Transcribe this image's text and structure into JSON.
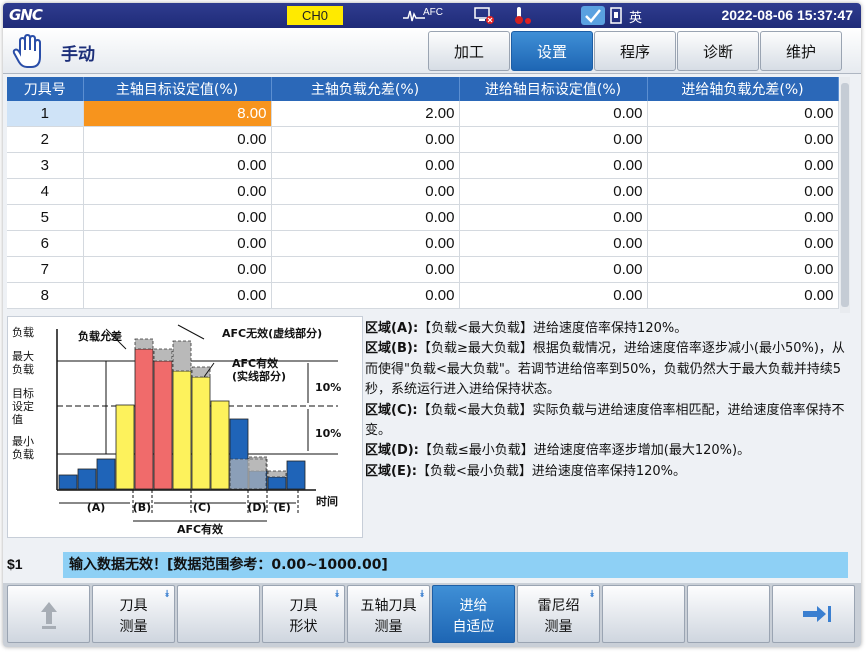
{
  "status": {
    "logo": "GNC",
    "channel": "CH0",
    "afc_label": "AFC",
    "language": "英",
    "datetime": "2022-08-06 15:37:47",
    "icons": [
      "afc-wave-icon",
      "network-error-icon",
      "temperature-icon",
      "check-icon",
      "sim-card-icon"
    ]
  },
  "header": {
    "mode": "手动",
    "mode_icon": "hand-icon",
    "tabs": [
      {
        "label": "加工",
        "active": false
      },
      {
        "label": "设置",
        "active": true
      },
      {
        "label": "程序",
        "active": false
      },
      {
        "label": "诊断",
        "active": false
      },
      {
        "label": "维护",
        "active": false
      }
    ]
  },
  "table": {
    "headers": [
      "刀具号",
      "主轴目标设定值(%)",
      "主轴负载允差(%)",
      "进给轴目标设定值(%)",
      "进给轴负载允差(%)"
    ],
    "rows": [
      [
        "1",
        "8.00",
        "2.00",
        "0.00",
        "0.00"
      ],
      [
        "2",
        "0.00",
        "0.00",
        "0.00",
        "0.00"
      ],
      [
        "3",
        "0.00",
        "0.00",
        "0.00",
        "0.00"
      ],
      [
        "4",
        "0.00",
        "0.00",
        "0.00",
        "0.00"
      ],
      [
        "5",
        "0.00",
        "0.00",
        "0.00",
        "0.00"
      ],
      [
        "6",
        "0.00",
        "0.00",
        "0.00",
        "0.00"
      ],
      [
        "7",
        "0.00",
        "0.00",
        "0.00",
        "0.00"
      ],
      [
        "8",
        "0.00",
        "0.00",
        "0.00",
        "0.00"
      ]
    ],
    "selected_cell": {
      "row": 0,
      "col": 1
    }
  },
  "diagram": {
    "y_labels": [
      "负载",
      "最大\n负载",
      "目标\n设定\n值",
      "最小\n负载"
    ],
    "tolerance_label": "负载允差",
    "afc_invalid_label": "AFC无效(虚线部分)",
    "afc_valid_label": "AFC有效\n(实线部分)",
    "percent_labels": [
      "10%",
      "10%"
    ],
    "region_labels": [
      "(A)",
      "(B)",
      "(C)",
      "(D)",
      "(E)"
    ],
    "time_label": "时间",
    "bottom_label": "AFC有效",
    "colors": {
      "blue": "#1f64b8",
      "red": "#f06b6b",
      "yellow": "#fdf25c",
      "gray": "#b9b9b9"
    }
  },
  "description": [
    {
      "region": "区域(A):",
      "text": "【负载<最大负载】进给速度倍率保持120%。"
    },
    {
      "region": "区域(B):",
      "text": "【负载≥最大负载】根据负载情况，进给速度倍率逐步减小(最小50%)，从而使得\"负载<最大负载\"。若调节进给倍率到50%，负载仍然大于最大负载并持续5秒，系统运行进入进给保持状态。"
    },
    {
      "region": "区域(C):",
      "text": "【负载<最大负载】实际负载与进给速度倍率相匹配，进给速度倍率保持不变。"
    },
    {
      "region": "区域(D):",
      "text": "【负载≤最小负载】进给速度倍率逐步增加(最大120%)。"
    },
    {
      "region": "区域(E):",
      "text": "【负载<最小负载】进给速度倍率保持120%。"
    }
  ],
  "message": {
    "channel": "$1",
    "text": "输入数据无效！[数据范围参考：0.00~1000.00]"
  },
  "softkeys": [
    {
      "l1": "",
      "l2": "",
      "icon": "up-arrow-icon",
      "chev": false,
      "active": false
    },
    {
      "l1": "刀具",
      "l2": "测量",
      "chev": true,
      "active": false
    },
    {
      "l1": "",
      "l2": "",
      "chev": false,
      "active": false
    },
    {
      "l1": "刀具",
      "l2": "形状",
      "chev": true,
      "active": false
    },
    {
      "l1": "五轴刀具",
      "l2": "测量",
      "chev": true,
      "active": false
    },
    {
      "l1": "进给",
      "l2": "自适应",
      "chev": false,
      "active": true
    },
    {
      "l1": "雷尼绍",
      "l2": "测量",
      "chev": true,
      "active": false
    },
    {
      "l1": "",
      "l2": "",
      "chev": false,
      "active": false
    },
    {
      "l1": "",
      "l2": "",
      "chev": false,
      "active": false
    },
    {
      "l1": "",
      "l2": "",
      "icon": "next-page-icon",
      "chev": false,
      "active": false
    }
  ]
}
